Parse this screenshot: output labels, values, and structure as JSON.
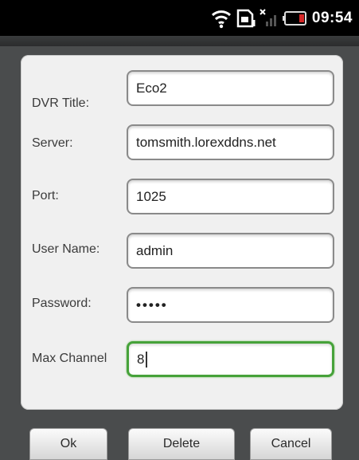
{
  "status_bar": {
    "time": "09:54",
    "icons": [
      "wifi-icon",
      "sd-card-icon",
      "signal-icon",
      "battery-icon"
    ]
  },
  "form": {
    "fields": [
      {
        "label": "DVR Title:",
        "value": "Eco2"
      },
      {
        "label": "Server:",
        "value": "tomsmith.lorexddns.net"
      },
      {
        "label": "Port:",
        "value": "1025"
      },
      {
        "label": "User Name:",
        "value": "admin"
      },
      {
        "label": "Password:",
        "value": "•••••"
      },
      {
        "label": "Max Channel",
        "value": "8"
      }
    ]
  },
  "buttons": {
    "ok": "Ok",
    "delete": "Delete",
    "cancel": "Cancel"
  },
  "colors": {
    "focus_border": "#46a23a",
    "battery": "#d62828"
  }
}
